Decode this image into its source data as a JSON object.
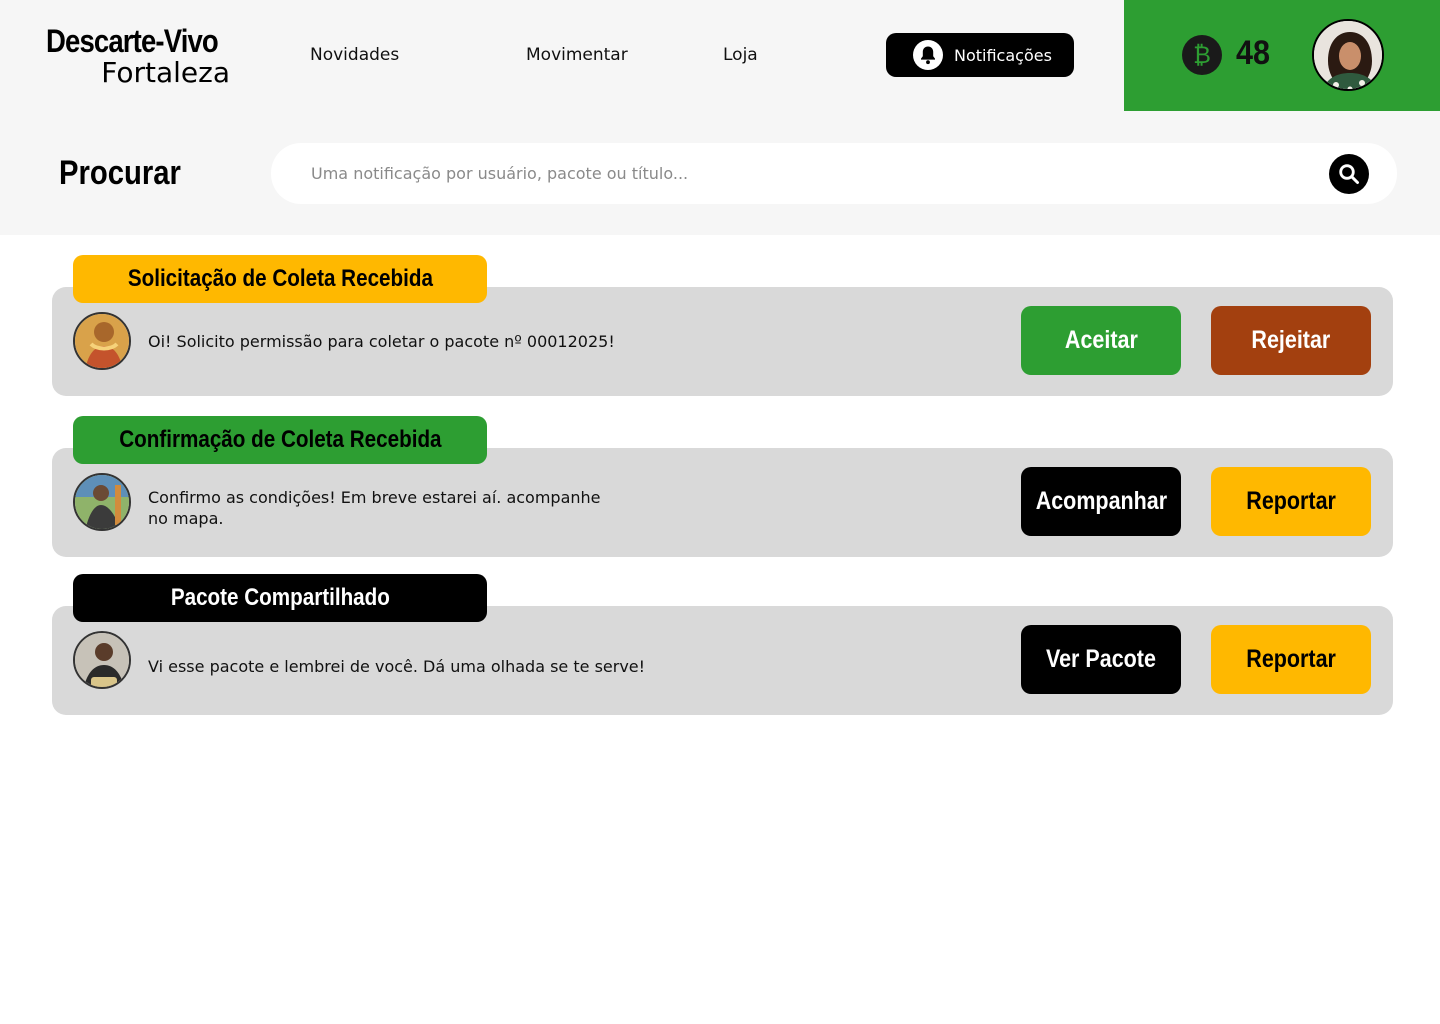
{
  "header": {
    "logo_main": "Descarte-Vivo",
    "logo_sub": "Fortaleza",
    "nav": {
      "novidades": "Novidades",
      "movimentar": "Movimentar",
      "loja": "Loja"
    },
    "notifications_label": "Notificações",
    "wallet": {
      "coin_symbol": "₿",
      "balance": "48",
      "color": "#2d9e32"
    }
  },
  "search": {
    "label": "Procurar",
    "placeholder": "Uma notificação por usuário, pacote ou título..."
  },
  "notifications": [
    {
      "tag": "Solicitação de Coleta Recebida",
      "tag_color": "#ffb800",
      "message": "Oi! Solicito permissão para coletar o pacote nº 00012025!",
      "primary_action": "Aceitar",
      "secondary_action": "Rejeitar"
    },
    {
      "tag": "Confirmação de Coleta Recebida",
      "tag_color": "#2d9e32",
      "message": "Confirmo as condições! Em breve estarei aí. acompanhe no mapa.",
      "primary_action": "Acompanhar",
      "secondary_action": "Reportar"
    },
    {
      "tag": "Pacote Compartilhado",
      "tag_color": "#000000",
      "message": "Vi esse pacote e lembrei de você. Dá uma olhada se te serve!",
      "primary_action": "Ver Pacote",
      "secondary_action": "Reportar"
    }
  ]
}
